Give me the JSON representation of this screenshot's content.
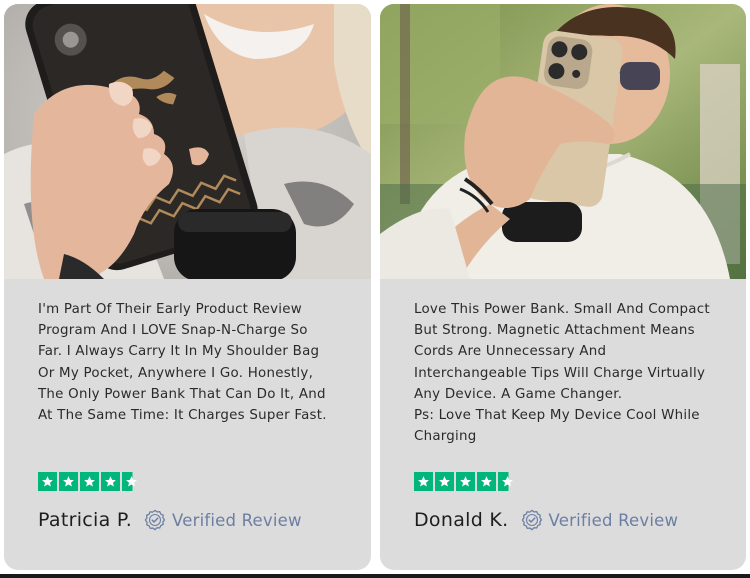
{
  "reviews": [
    {
      "text": "I'm Part Of Their Early Product Review\nProgram And I LOVE Snap-N-Charge So\nFar. I Always Carry It In My Shoulder Bag\nOr My Pocket, Anywhere I Go. Honestly,\nThe Only Power Bank That Can Do It, And\nAt The Same Time: It Charges Super Fast.",
      "rating": 4.8,
      "name": "Patricia P.",
      "verified_label": "Verified Review"
    },
    {
      "text": "Love This Power Bank. Small And Compact\nBut Strong. Magnetic Attachment Means\nCords Are Unnecessary And\nInterchangeable Tips Will Charge Virtually\nAny Device. A Game Changer.\nPs: Love That Keep My Device Cool While\nCharging",
      "rating": 4.8,
      "name": "Donald K.",
      "verified_label": "Verified Review"
    }
  ],
  "colors": {
    "card_background": "#dcdcdc",
    "star_green": "#00b67a",
    "verified_blue": "#6c7ea3"
  },
  "icons": {
    "rating": "star-icon",
    "verified": "verified-badge-icon"
  }
}
